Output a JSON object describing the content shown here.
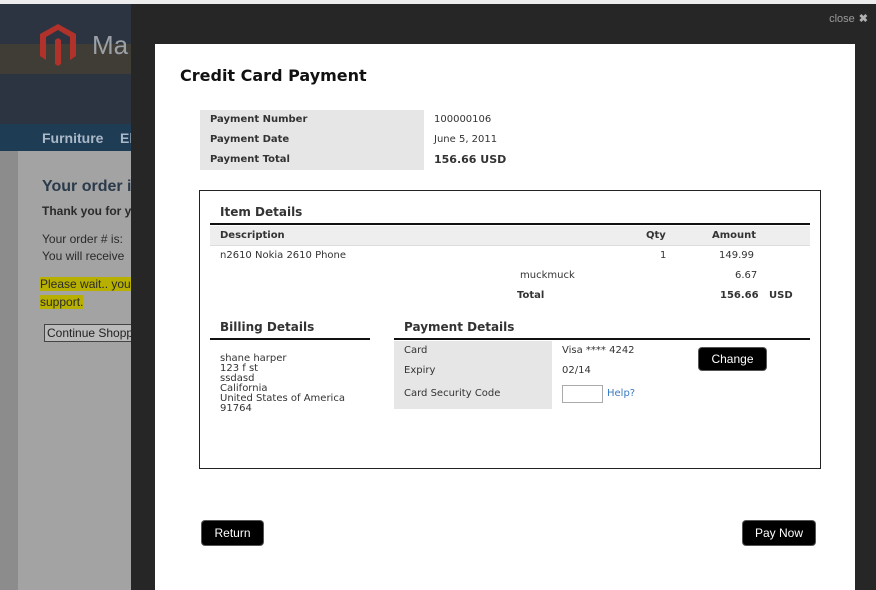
{
  "background": {
    "brand": "Ma",
    "nav": [
      "Furniture",
      "El"
    ],
    "heading": "Your order i",
    "lines": [
      "Thank you for yo",
      "Your order # is: ",
      "You will receive"
    ],
    "wait_line1": "Please wait.. you",
    "wait_line2": "support.",
    "continue_button": "Continue Shopp"
  },
  "overlay": {
    "close_label": "close",
    "close_glyph": "✖"
  },
  "modal": {
    "title": "Credit Card Payment",
    "summary": {
      "payment_number_label": "Payment Number",
      "payment_number": "100000106",
      "payment_date_label": "Payment Date",
      "payment_date": "June 5, 2011",
      "payment_total_label": "Payment Total",
      "payment_total": "156.66 USD"
    },
    "item_details": {
      "title": "Item Details",
      "columns": {
        "description": "Description",
        "qty": "Qty",
        "amount": "Amount"
      },
      "item": {
        "description": "n2610 Nokia 2610 Phone",
        "qty": "1",
        "amount": "149.99"
      },
      "extra": {
        "label": "muckmuck",
        "amount": "6.67"
      },
      "total": {
        "label": "Total",
        "amount": "156.66",
        "currency": "USD"
      }
    },
    "billing": {
      "title": "Billing Details",
      "name": "shane harper",
      "street": "123 f st",
      "line2": "ssdasd",
      "state": "California",
      "country": "United States of America",
      "zip": "91764"
    },
    "payment": {
      "title": "Payment Details",
      "card_label": "Card",
      "card_value": "Visa **** 4242",
      "expiry_label": "Expiry",
      "expiry_value": "02/14",
      "csc_label": "Card Security Code",
      "csc_value": "",
      "help_link": "Help?",
      "change_button": "Change"
    },
    "return_button": "Return",
    "pay_now_button": "Pay Now"
  },
  "colors": {
    "overlay": "#262626",
    "button": "#000000",
    "link": "#3a7abf",
    "label_bg": "#e6e6e6"
  }
}
